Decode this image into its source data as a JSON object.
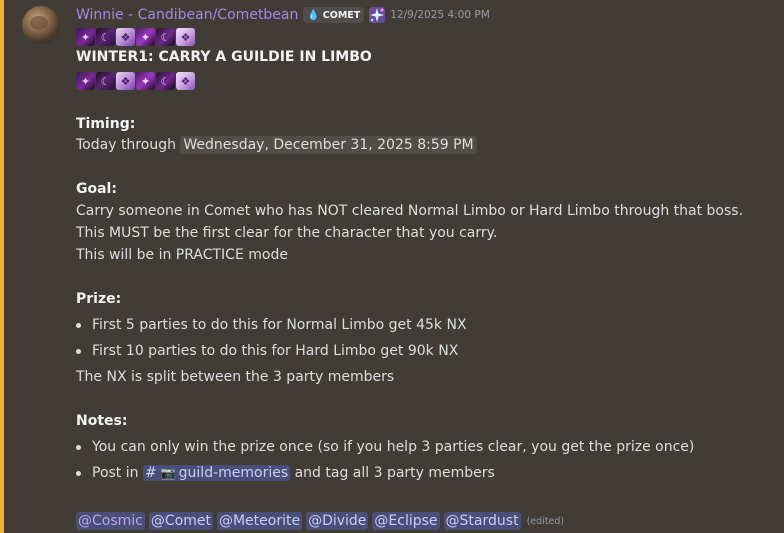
{
  "message": {
    "username": "Winnie - Candibean/Cometbean",
    "guild_tag": {
      "icon": "water-drop-icon",
      "label": "COMET"
    },
    "role_icon": "sparkle-icon",
    "timestamp": "12/9/2025 4:00 PM",
    "emoji_row": [
      "emoji-1",
      "emoji-2",
      "emoji-3",
      "emoji-4",
      "emoji-5",
      "emoji-6"
    ],
    "title": "WINTER1: CARRY A GUILDIE IN LIMBO",
    "timing": {
      "heading": "Timing:",
      "prefix": "Today through",
      "date": "Wednesday, December 31, 2025 8:59 PM"
    },
    "goal": {
      "heading": "Goal:",
      "lines": [
        "Carry someone in Comet who has NOT cleared Normal Limbo or Hard Limbo through that boss.",
        "This MUST be the first clear for the character that you carry.",
        "This will be in PRACTICE mode"
      ]
    },
    "prize": {
      "heading": "Prize:",
      "bullets": [
        "First 5 parties to do this for Normal Limbo get 45k NX",
        "First 10 parties to do this for Hard Limbo get 90k NX"
      ],
      "footer": "The NX is split between the 3 party members"
    },
    "notes": {
      "heading": "Notes:",
      "bullet1": "You can only win the prize once (so if you help 3 parties clear, you get the prize once)",
      "bullet2_prefix": "Post in",
      "channel_hash": "#",
      "channel_icon": "camera-icon",
      "channel_name": "guild-memories",
      "bullet2_suffix": "and tag all 3 party members"
    },
    "mentions": [
      "@Cosmic",
      "@Comet",
      "@Meteorite",
      "@Divide",
      "@Eclipse",
      "@Stardust"
    ],
    "edited": "(edited)"
  },
  "colors": {
    "background": "#413d36",
    "accent_bar": "#f0b232",
    "username": "#a287e6",
    "mention_bg": "#4a4f78",
    "mention_text": "#c9cdfb"
  }
}
